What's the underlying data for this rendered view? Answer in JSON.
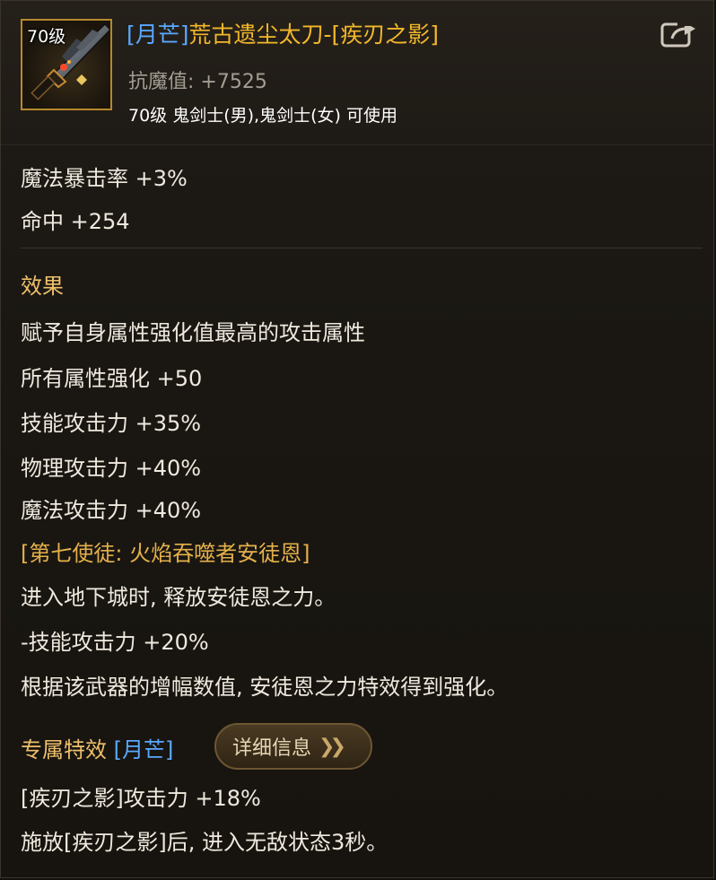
{
  "header": {
    "level_badge": "70级",
    "grade": "[月芒]",
    "name": "荒古遗尘太刀-[疾刃之影]",
    "resist": "抗魔值: +7525",
    "usable": "70级 鬼剑士(男),鬼剑士(女) 可使用"
  },
  "stats": [
    "魔法暴击率 +3%",
    "命中 +254"
  ],
  "effect": {
    "heading": "效果",
    "lines": [
      "赋予自身属性强化值最高的攻击属性",
      "所有属性强化 +50",
      "技能攻击力 +35%",
      "物理攻击力 +40%",
      "魔法攻击力 +40%"
    ]
  },
  "apostle": {
    "title": "[第七使徒: 火焰吞噬者安徒恩]",
    "lines": [
      "进入地下城时, 释放安徒恩之力。",
      "-技能攻击力 +20%",
      "根据该武器的增幅数值, 安徒恩之力特效得到强化。"
    ]
  },
  "exclusive": {
    "label": "专属特效",
    "grade": "[月芒]",
    "detail_button": "详细信息",
    "lines": [
      "[疾刃之影]攻击力 +18%",
      "施放[疾刃之影]后, 进入无敌状态3秒。"
    ]
  },
  "colors": {
    "grade_blue": "#5aa8ff",
    "item_gold": "#f2b72a",
    "heading_gold": "#efc06b"
  }
}
